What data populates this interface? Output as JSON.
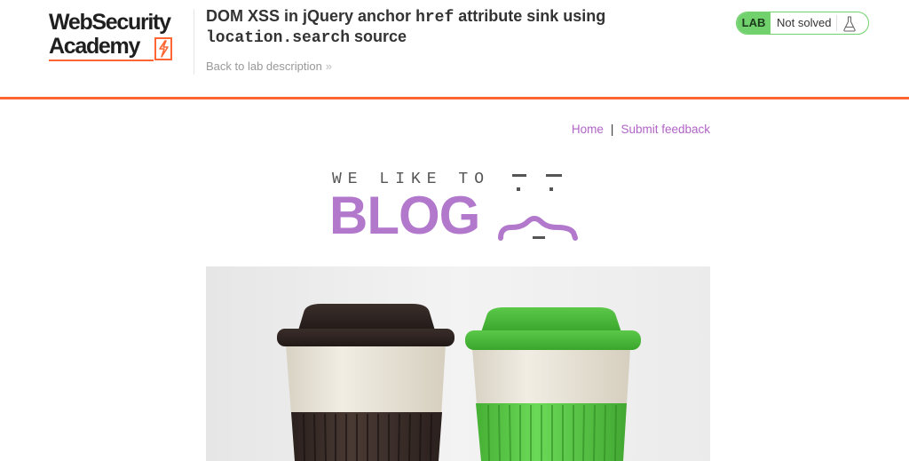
{
  "academy": {
    "logo_line1": "WebSecurity",
    "logo_line2": "Academy",
    "title_part1": "DOM XSS in jQuery anchor ",
    "title_code1": "href",
    "title_part2": " attribute sink using ",
    "title_code2": "location.search",
    "title_part3": " source",
    "back_link": "Back to lab description",
    "back_chevron": "»",
    "lab_tag": "LAB",
    "lab_status": "Not solved"
  },
  "nav": {
    "home": "Home",
    "separator": "|",
    "feedback": "Submit feedback"
  },
  "blog_logo": {
    "top_text": "WE LIKE TO",
    "word": "BLOG"
  },
  "hero": {
    "subject": "two reusable coffee cups, brown and green"
  },
  "colors": {
    "accent_orange": "#ff6633",
    "lab_green": "#70d16d",
    "blog_purple": "#b278cc",
    "link_purple": "#b064c6"
  }
}
